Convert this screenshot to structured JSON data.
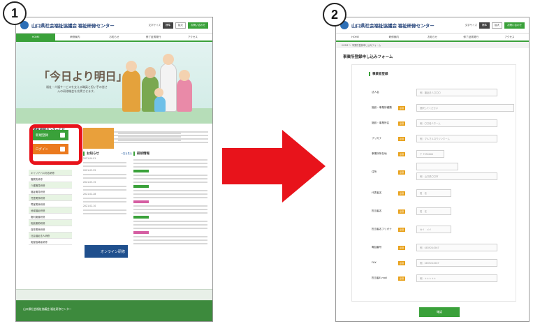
{
  "steps": [
    "1",
    "2"
  ],
  "site": {
    "name": "山口県社会福祉協議会 福祉研修センター",
    "header_small": [
      "文字サイズ",
      "標準",
      "拡大"
    ],
    "contact": "お問い合わせ",
    "nav": [
      "HOME",
      "研修案内",
      "お知らせ",
      "修了証書発行",
      "アクセス"
    ]
  },
  "screen1": {
    "hero_title": "「今日より明日」",
    "hero_sub": "福祉・介護サービスを支える職員と担い手の皆さんの研修機会を充実させます。",
    "about_title": "福祉研修センターとは",
    "register_label": "新規登録",
    "login_label": "ログイン",
    "news_title": "お知らせ",
    "news_more": "一覧を見る",
    "training_title": "研修情報",
    "side_items": [
      "キャリアパス対応研修",
      "階層別研修",
      "介護職員研修",
      "福祉職員研修",
      "児童関係研修",
      "障害関係研修",
      "地域福祉研修",
      "権利擁護研修",
      "相談援助研修",
      "保育関係研修",
      "社会福祉法人研修",
      "実習指導者研修"
    ],
    "news_dates": [
      "2021.04.01",
      "2021.03.25",
      "2021.03.15",
      "2021.02.28",
      "2021.02.10"
    ],
    "online_banner": "オンライン研修",
    "footer_name": "山口県社会福祉協議会 福祉研修センター"
  },
  "screen2": {
    "breadcrumb": "HOME ＞ 事業所登録申し込みフォーム",
    "form_title": "事業所登録申し込みフォーム",
    "section": "事業者登録",
    "required": "必須",
    "fields": [
      {
        "label": "法人名",
        "placeholder": "例）福祉法人〇〇〇",
        "required": false
      },
      {
        "label": "施設・事業所種類",
        "placeholder": "選択してください",
        "required": true
      },
      {
        "label": "施設・事業所名",
        "placeholder": "例）〇〇老人ホーム",
        "required": true
      },
      {
        "label": "フリガナ",
        "placeholder": "例）マルマルロウジンホーム",
        "required": true
      },
      {
        "label": "事業所所在地",
        "placeholder": "〒 7530000",
        "required": true
      },
      {
        "label": "住所",
        "placeholder": "例）山口県〇〇市",
        "required": true
      },
      {
        "label": "代表者名",
        "placeholder": "姓　名",
        "required": true
      },
      {
        "label": "担当者名",
        "placeholder": "姓　名",
        "required": true
      },
      {
        "label": "担当者名フリガナ",
        "placeholder": "セイ　メイ",
        "required": true
      },
      {
        "label": "電話番号",
        "placeholder": "例）0839244567",
        "required": true
      },
      {
        "label": "FAX",
        "placeholder": "例）0839244567",
        "required": true
      },
      {
        "label": "担当者E-mail",
        "placeholder": "例）＊＊＊＊＊",
        "required": true
      }
    ],
    "submit": "確認"
  }
}
